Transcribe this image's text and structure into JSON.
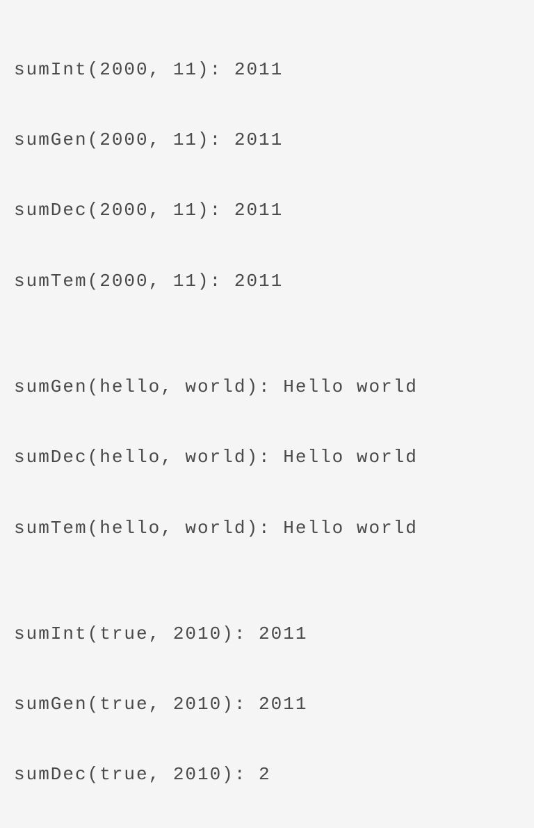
{
  "lines": [
    "sumInt(2000, 11): 2011",
    "sumGen(2000, 11): 2011",
    "sumDec(2000, 11): 2011",
    "sumTem(2000, 11): 2011",
    "",
    "sumGen(hello, world): Hello world",
    "sumDec(hello, world): Hello world",
    "sumTem(hello, world): Hello world",
    "",
    "sumInt(true, 2010): 2011",
    "sumGen(true, 2010): 2011",
    "sumDec(true, 2010): 2"
  ]
}
